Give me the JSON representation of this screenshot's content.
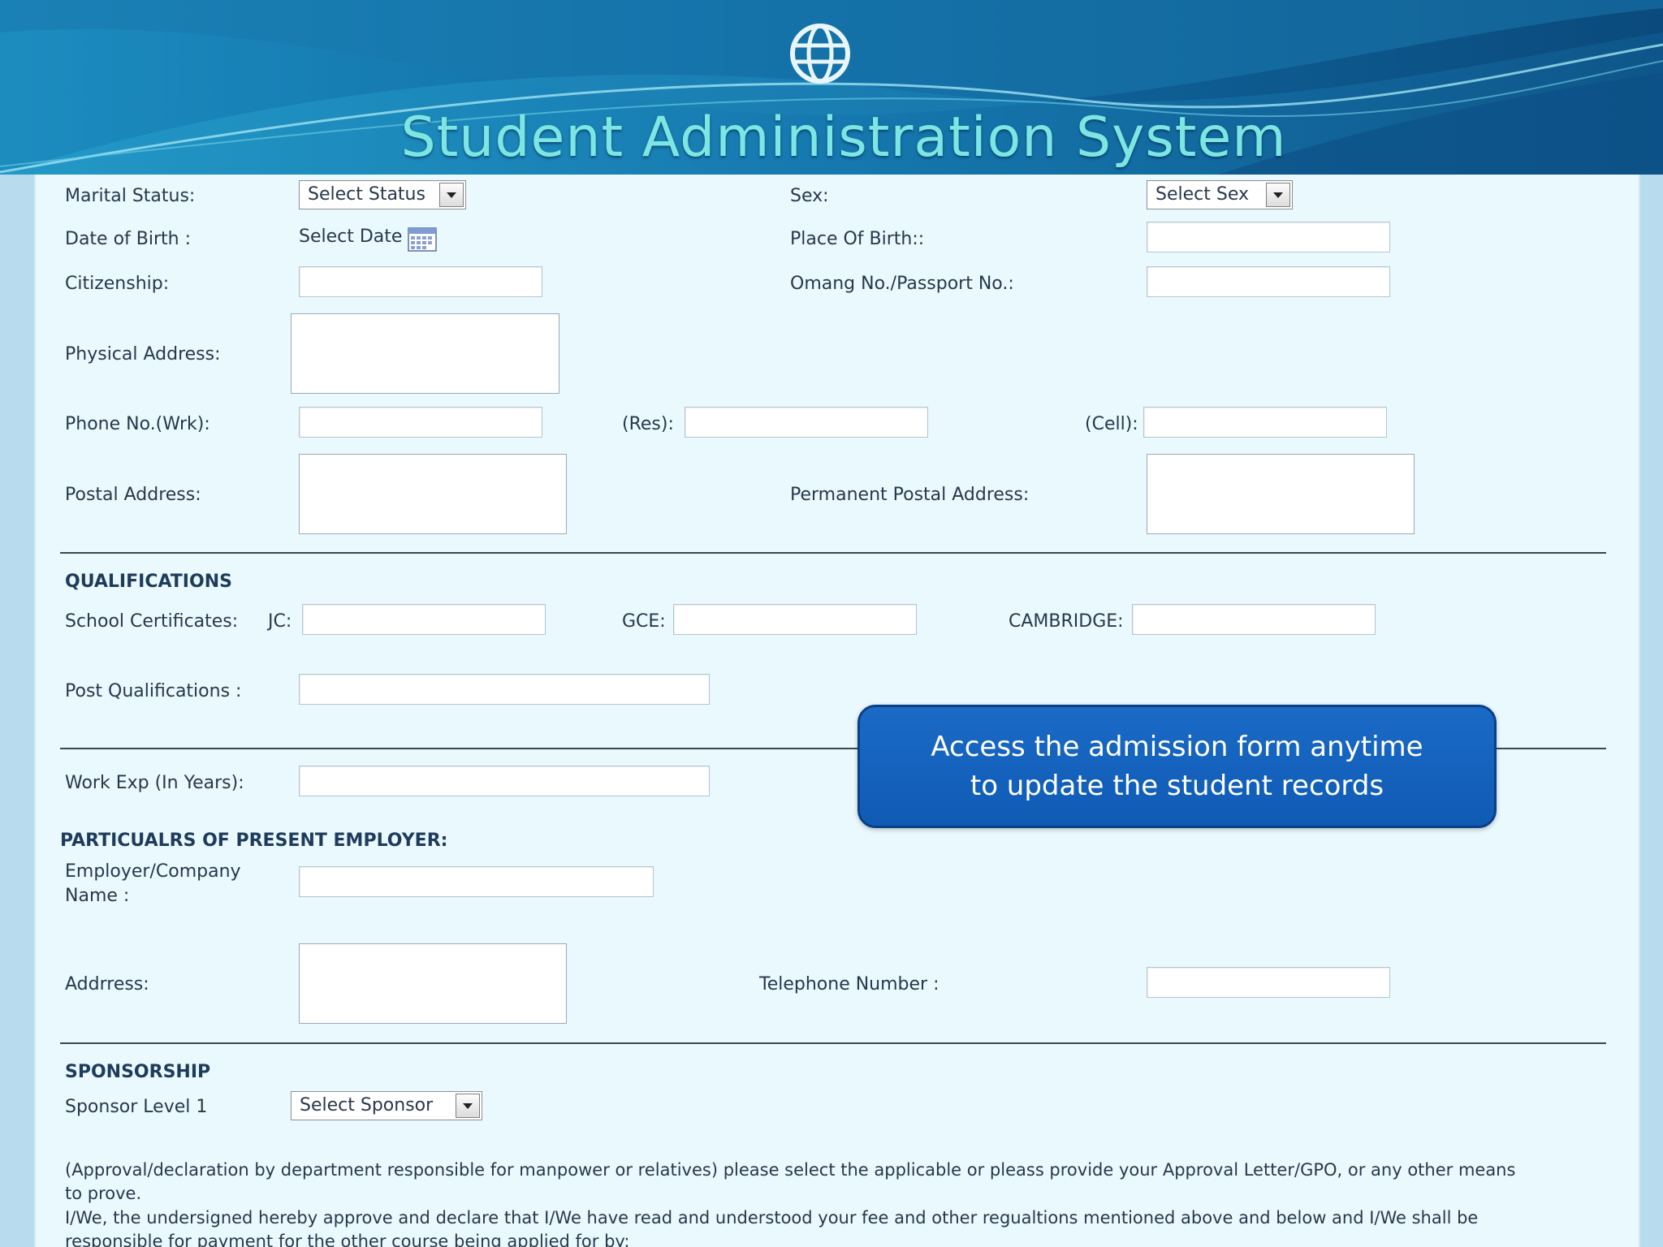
{
  "header": {
    "title": "Student Administration System",
    "logo_icon": "globe-logo-icon"
  },
  "personal": {
    "marital_status_label": "Marital Status:",
    "marital_status_value": "Select Status",
    "sex_label": "Sex:",
    "sex_value": "Select Sex",
    "dob_label": "Date of Birth :",
    "dob_value": "Select Date",
    "place_of_birth_label": "Place Of Birth::",
    "citizenship_label": "Citizenship:",
    "omang_label": "Omang No./Passport No.:",
    "physical_address_label": "Physical Address:",
    "phone_wrk_label": "Phone No.(Wrk):",
    "phone_res_label": "(Res):",
    "phone_cell_label": "(Cell):",
    "postal_address_label": "Postal Address:",
    "permanent_postal_label": "Permanent Postal Address:"
  },
  "qualifications": {
    "heading": "QUALIFICATIONS",
    "school_certificates_label": "School Certificates:",
    "jc_label": "JC:",
    "gce_label": "GCE:",
    "cambridge_label": "CAMBRIDGE:",
    "post_qualifications_label": "Post Qualifications :"
  },
  "work": {
    "work_exp_label": "Work Exp (In Years):"
  },
  "employer": {
    "heading": "PARTICUALRS OF PRESENT EMPLOYER:",
    "company_label_line1": "Employer/Company",
    "company_label_line2": "Name :",
    "address_label": "Addrress:",
    "telephone_label": "Telephone Number :"
  },
  "sponsorship": {
    "heading": "SPONSORSHIP",
    "sponsor_level_label": "Sponsor Level 1",
    "sponsor_value": "Select Sponsor",
    "note_line1": "(Approval/declaration by department responsible for manpower or relatives) please select the applicable or pleass provide your Approval Letter/GPO, or any other means",
    "note_line2": "to prove.",
    "declaration_line1": "I/We, the undersigned hereby approve and declare that I/We have read and understood your fee and other regualtions mentioned above and below and I/We shall be",
    "declaration_line2": "responsible for payment for the other course being applied for by:"
  },
  "callout": {
    "text": "Access the admission form anytime to update the student records"
  },
  "colors": {
    "header_bg": "#0c5c8f",
    "title": "#7de6e2",
    "form_bg": "#e9f9fd",
    "callout_bg": "#1462bd"
  }
}
